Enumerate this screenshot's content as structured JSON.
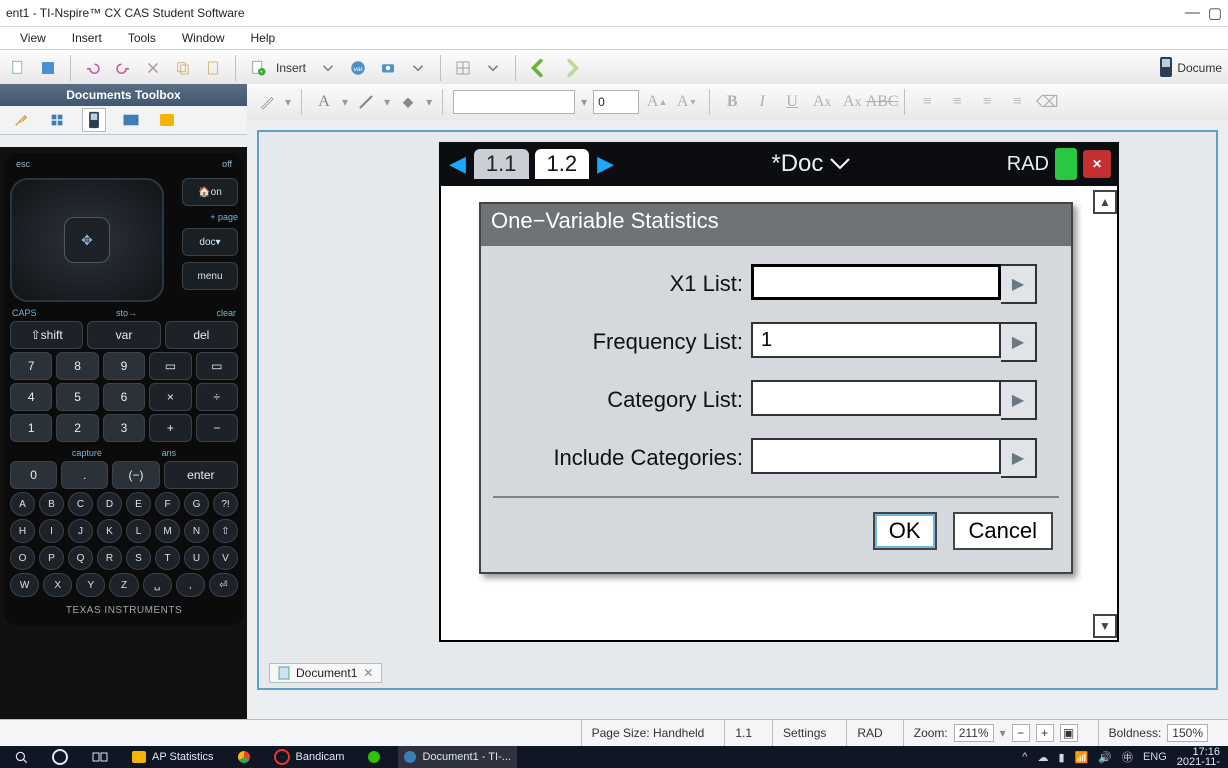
{
  "window": {
    "title": "ent1 - TI-Nspire™ CX CAS Student Software"
  },
  "menu": [
    "View",
    "Insert",
    "Tools",
    "Window",
    "Help"
  ],
  "toolbar1": {
    "insert_label": "Insert",
    "documents_label": "Docume"
  },
  "toolbar2": {
    "font_size": "0"
  },
  "toolbox": {
    "header": "Documents Toolbox"
  },
  "calculator": {
    "top_left": "esc",
    "off": "off",
    "on": "on",
    "page": "+ page",
    "doc": "doc",
    "menu": "menu",
    "caps": "CAPS",
    "sto": "sto→",
    "clear": "clear",
    "shift": "⇧shift",
    "var": "var",
    "del": "del",
    "capture": "capture",
    "ans": "ans",
    "enter": "enter",
    "numbers_row1": [
      "7",
      "8",
      "9"
    ],
    "numbers_row2": [
      "4",
      "5",
      "6",
      "×",
      "÷"
    ],
    "numbers_row3": [
      "1",
      "2",
      "3",
      "+",
      "−"
    ],
    "numbers_row4": [
      "0",
      ".",
      "(−)"
    ],
    "alpha_row1": [
      "A",
      "B",
      "C",
      "D",
      "E",
      "F",
      "G",
      "?!"
    ],
    "alpha_row2": [
      "H",
      "I",
      "J",
      "K",
      "L",
      "M",
      "N",
      "⇧"
    ],
    "alpha_row3": [
      "O",
      "P",
      "Q",
      "R",
      "S",
      "T",
      "U",
      "V"
    ],
    "alpha_row4": [
      "W",
      "X",
      "Y",
      "Z",
      "␣",
      ",",
      "⏎"
    ],
    "logo": "TEXAS INSTRUMENTS"
  },
  "handheld": {
    "tabs": [
      "1.1",
      "1.2"
    ],
    "doc_title": "*Doc",
    "mode": "RAD"
  },
  "dialog": {
    "title": "One−Variable Statistics",
    "rows": [
      {
        "label": "X1 List:",
        "value": ""
      },
      {
        "label": "Frequency List:",
        "value": "1"
      },
      {
        "label": "Category List:",
        "value": ""
      },
      {
        "label": "Include Categories:",
        "value": ""
      }
    ],
    "ok": "OK",
    "cancel": "Cancel"
  },
  "doctab": {
    "name": "Document1"
  },
  "status": {
    "page_size": "Page Size: Handheld",
    "page": "1.1",
    "settings": "Settings",
    "angle": "RAD",
    "zoom_label": "Zoom:",
    "zoom_value": "211%",
    "boldness_label": "Boldness:",
    "boldness_value": "150%"
  },
  "taskbar": {
    "items": [
      {
        "label": "AP Statistics"
      },
      {
        "label": "Bandicam"
      },
      {
        "label": "Document1 - TI-..."
      }
    ],
    "lang": "ENG",
    "time": "17:16",
    "date": "2021-11-"
  }
}
